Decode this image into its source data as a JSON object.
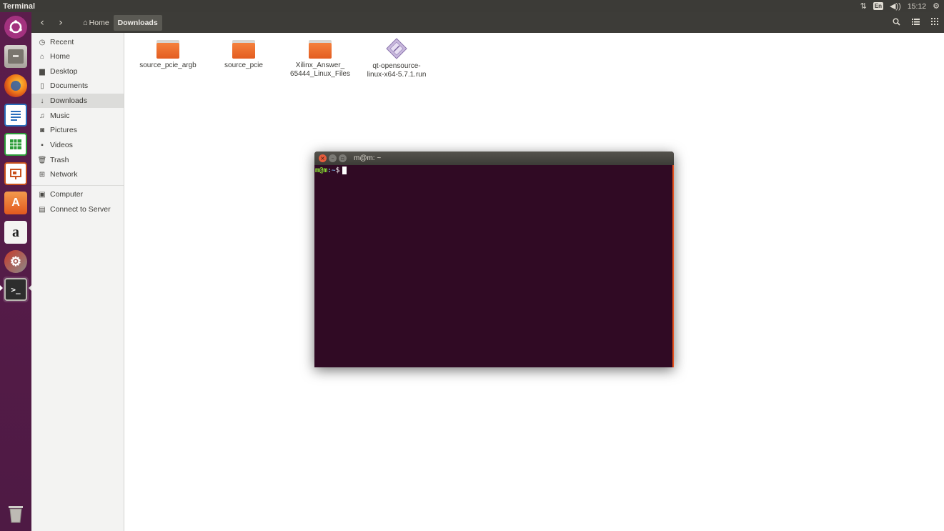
{
  "topbar": {
    "app_title": "Terminal",
    "keyboard_layout": "En",
    "clock": "15:12"
  },
  "file_manager": {
    "breadcrumb": {
      "home_label": "Home",
      "current_label": "Downloads"
    },
    "sidebar": {
      "items": [
        {
          "label": "Recent",
          "icon": "clock-icon"
        },
        {
          "label": "Home",
          "icon": "home-icon"
        },
        {
          "label": "Desktop",
          "icon": "folder-icon"
        },
        {
          "label": "Documents",
          "icon": "document-icon"
        },
        {
          "label": "Downloads",
          "icon": "download-icon",
          "selected": true
        },
        {
          "label": "Music",
          "icon": "music-icon"
        },
        {
          "label": "Pictures",
          "icon": "camera-icon"
        },
        {
          "label": "Videos",
          "icon": "video-icon"
        },
        {
          "label": "Trash",
          "icon": "trash-icon"
        },
        {
          "label": "Network",
          "icon": "network-icon"
        },
        {
          "label": "Computer",
          "icon": "computer-icon"
        },
        {
          "label": "Connect to Server",
          "icon": "server-icon"
        }
      ]
    },
    "files": [
      {
        "name_line1": "source_pcie_argb",
        "name_line2": "",
        "type": "folder"
      },
      {
        "name_line1": "source_pcie",
        "name_line2": "",
        "type": "folder"
      },
      {
        "name_line1": "Xilinx_Answer_",
        "name_line2": "65444_Linux_Files",
        "type": "folder"
      },
      {
        "name_line1": "qt-opensource-",
        "name_line2": "linux-x64-5.7.1.run",
        "type": "package"
      }
    ]
  },
  "terminal": {
    "window_title": "m@m: ~",
    "prompt_user_host": "m@m",
    "prompt_path": ":~",
    "prompt_symbol": "$"
  },
  "colors": {
    "launcher_bg": "#5b1d4c",
    "terminal_bg": "#300a24",
    "accent_orange": "#e95420",
    "prompt_green": "#8ae234"
  }
}
